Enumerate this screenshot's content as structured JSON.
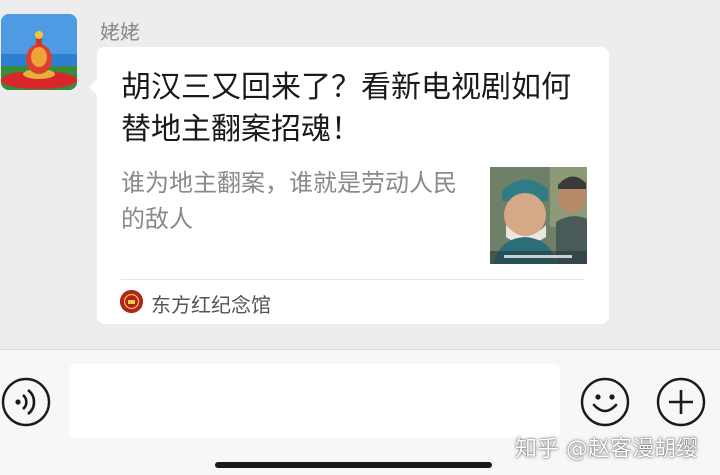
{
  "chat": {
    "sender_name": "姥姥",
    "card": {
      "title": "胡汉三又回来了？看新电视剧如何替地主翻案招魂！",
      "description": "谁为地主翻案，谁就是劳动人民的敌人",
      "source_name": "东方红纪念馆"
    }
  },
  "input_bar": {
    "message_value": "",
    "voice_icon": "voice-icon",
    "emoji_icon": "emoji-icon",
    "plus_icon": "plus-icon"
  },
  "watermark": "知乎 @赵客漫胡缨",
  "colors": {
    "background": "#ededed",
    "bubble": "#ffffff",
    "source_logo": "#b3231b"
  }
}
